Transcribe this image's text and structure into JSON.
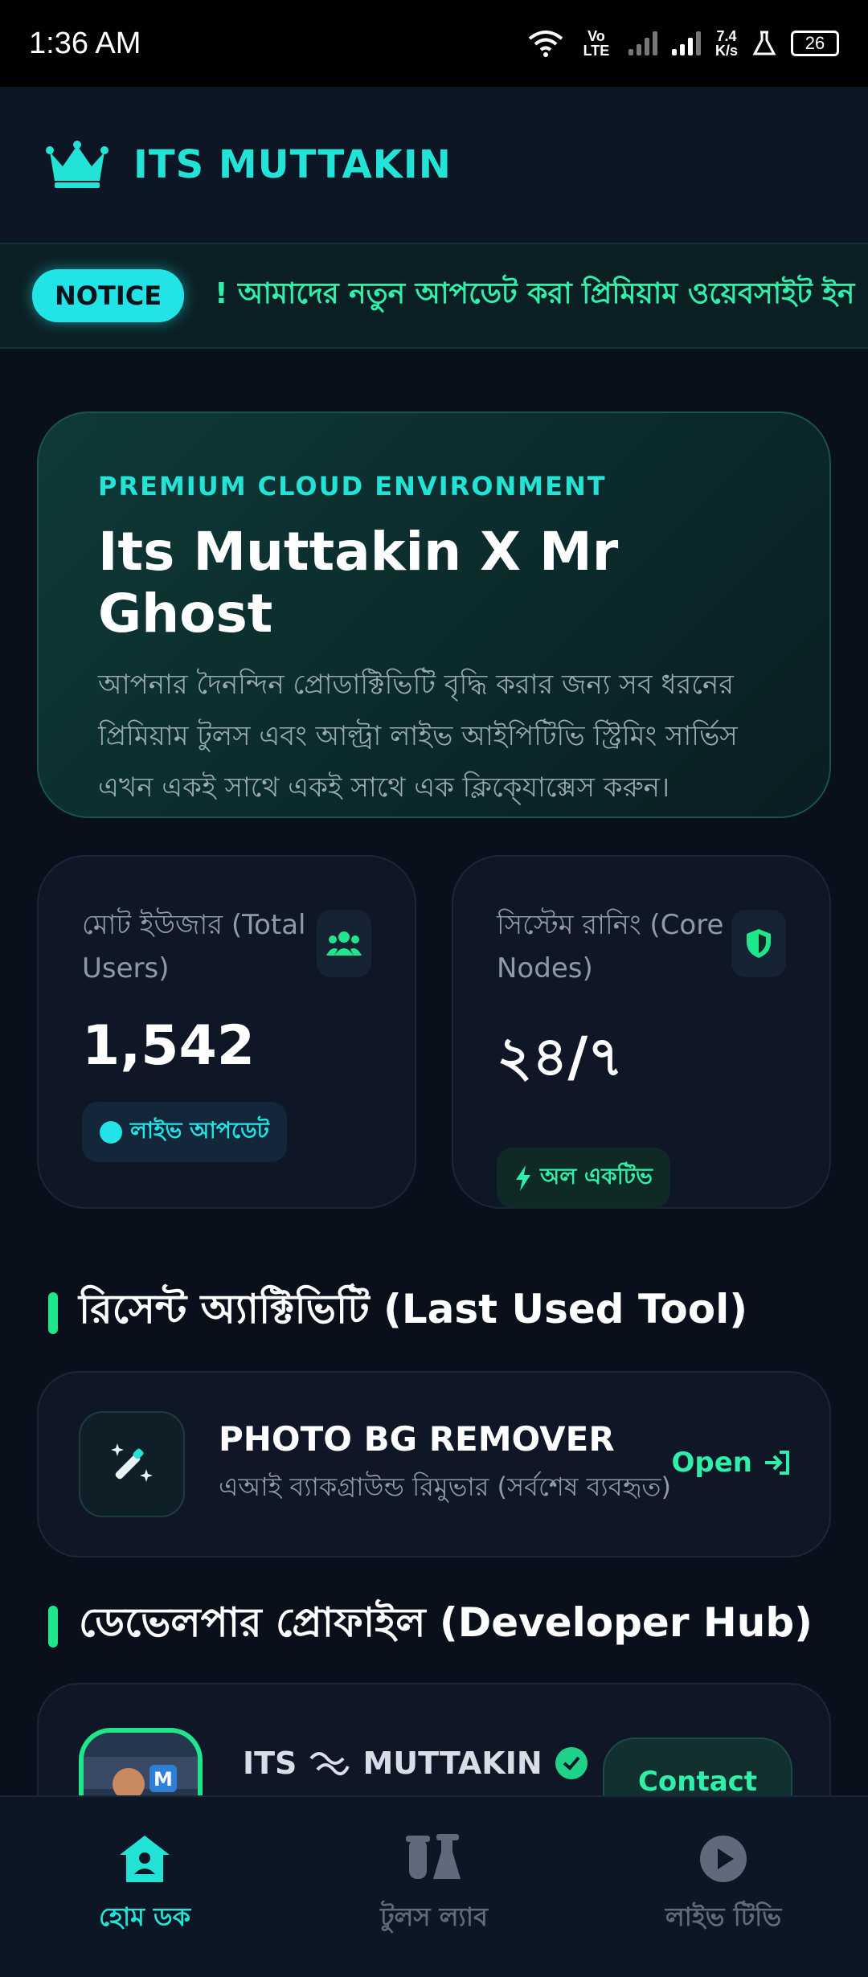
{
  "status_bar": {
    "time": "1:36 AM",
    "network": "Vo LTE",
    "speed_value": "7.4",
    "speed_unit": "K/s",
    "battery": "26"
  },
  "header": {
    "brand": "ITS MUTTAKIN",
    "logo_icon": "crown-icon"
  },
  "notice": {
    "label": "NOTICE",
    "text": "! আমাদের নতুন আপডেট করা প্রিমিয়াম ওয়েবসাইট ইন"
  },
  "hero": {
    "eyebrow": "PREMIUM CLOUD ENVIRONMENT",
    "title": "Its Muttakin X Mr Ghost",
    "description_lines": [
      "আপনার দৈনন্দিন প্রোডাক্টিভিটি বৃদ্ধি করার জন্য সব ধরনের",
      "প্রিমিয়াম টুলস এবং আল্ট্রা লাইভ আইপিটিভি স্ট্রিমিং সার্ভিস",
      "এখন একই সাথে একই সাথে এক ক্লিকে্যাক্সেস করুন।"
    ]
  },
  "stats": [
    {
      "label_line1": "মোট ইউজার (Total",
      "label_line2": "Users)",
      "value": "1,542",
      "badge": "লাইভ আপডেট",
      "icon": "users-icon"
    },
    {
      "label_line1": "সিস্টেম রানিং (Core",
      "label_line2": "Nodes)",
      "value": "২৪/৭",
      "badge": "অল একটিভ",
      "icon": "shield-icon"
    }
  ],
  "recent_activity": {
    "section_title": "রিসেন্ট অ্যাক্টিভিটি (Last Used Tool)",
    "tool_name": "PHOTO BG REMOVER",
    "tool_desc": "এআই ব্যাকগ্রাউন্ড রিমুভার (সর্বশেষ ব্যবহৃত)",
    "open_label": "Open"
  },
  "developer": {
    "section_title": "ডেভেলপার প্রোফাইল (Developer Hub)",
    "name_left": "ITS",
    "name_right": "MUTTAKIN",
    "contact_label": "Contact"
  },
  "bottom_nav": [
    {
      "label": "হোম ডক",
      "icon": "home-icon",
      "active": true
    },
    {
      "label": "টুলস ল্যাব",
      "icon": "flask-icon",
      "active": false
    },
    {
      "label": "লাইভ টিভি",
      "icon": "play-icon",
      "active": false
    }
  ],
  "colors": {
    "accent_cyan": "#22e3d6",
    "accent_green": "#1fe58b",
    "background": "#0a0f1c"
  }
}
